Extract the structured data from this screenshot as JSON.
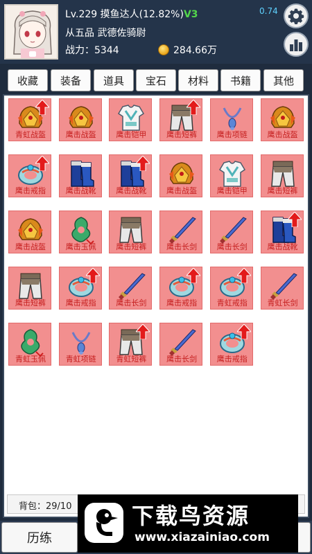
{
  "header": {
    "level_text": "Lv.229 摸鱼达人(12.82%)",
    "vip": "V3",
    "title": "从五品  武德佐骑尉",
    "power": "战力：5344",
    "gold": "284.66万",
    "top_stat": "0.74"
  },
  "tabs": [
    "收藏",
    "装备",
    "道具",
    "宝石",
    "材料",
    "书籍",
    "其他"
  ],
  "items": [
    {
      "name": "青虹战盔",
      "icon": "helmet-icon",
      "upgrade": true
    },
    {
      "name": "鹰击战盔",
      "icon": "helmet-icon",
      "upgrade": false
    },
    {
      "name": "鹰击铠甲",
      "icon": "armor-icon",
      "upgrade": false
    },
    {
      "name": "鹰击短裤",
      "icon": "pants-icon",
      "upgrade": true
    },
    {
      "name": "鹰击项链",
      "icon": "necklace-icon",
      "upgrade": false
    },
    {
      "name": "鹰击战盔",
      "icon": "helmet-icon",
      "upgrade": false
    },
    {
      "name": "鹰击戒指",
      "icon": "ring-icon",
      "upgrade": true
    },
    {
      "name": "鹰击战靴",
      "icon": "boots-icon",
      "upgrade": false
    },
    {
      "name": "鹰击战靴",
      "icon": "boots-icon",
      "upgrade": true
    },
    {
      "name": "鹰击战盔",
      "icon": "helmet-icon",
      "upgrade": false
    },
    {
      "name": "鹰击铠甲",
      "icon": "armor-icon",
      "upgrade": false
    },
    {
      "name": "鹰击短裤",
      "icon": "pants-icon",
      "upgrade": false
    },
    {
      "name": "鹰击战盔",
      "icon": "helmet-icon",
      "upgrade": false
    },
    {
      "name": "鹰击玉佩",
      "icon": "jade-pendant-icon",
      "upgrade": false
    },
    {
      "name": "鹰击短裤",
      "icon": "pants-icon",
      "upgrade": false
    },
    {
      "name": "鹰击长剑",
      "icon": "sword-icon",
      "upgrade": false
    },
    {
      "name": "鹰击长剑",
      "icon": "sword-icon",
      "upgrade": false
    },
    {
      "name": "鹰击战靴",
      "icon": "boots-icon",
      "upgrade": true
    },
    {
      "name": "鹰击短裤",
      "icon": "pants-icon",
      "upgrade": false
    },
    {
      "name": "鹰击戒指",
      "icon": "ring-icon",
      "upgrade": true
    },
    {
      "name": "鹰击长剑",
      "icon": "sword-icon",
      "upgrade": false
    },
    {
      "name": "鹰击戒指",
      "icon": "ring-icon",
      "upgrade": true
    },
    {
      "name": "青虹戒指",
      "icon": "ring-icon",
      "upgrade": true
    },
    {
      "name": "青虹长剑",
      "icon": "sword-icon",
      "upgrade": false
    },
    {
      "name": "青虹玉佩",
      "icon": "jade-pendant-icon",
      "upgrade": false
    },
    {
      "name": "青虹项链",
      "icon": "necklace-icon",
      "upgrade": false
    },
    {
      "name": "青虹短裤",
      "icon": "pants-icon",
      "upgrade": true
    },
    {
      "name": "鹰击长剑",
      "icon": "sword-icon",
      "upgrade": false
    },
    {
      "name": "鹰击戒指",
      "icon": "ring-icon",
      "upgrade": true
    }
  ],
  "bag": "背包：29/10",
  "bottom_nav": [
    "历练"
  ],
  "watermark": {
    "cn": "下载鸟资源",
    "url": "www.xiazainiao.com"
  },
  "colors": {
    "slot_bg": "#f28f8f",
    "label_red": "#c62020",
    "upgrade_arrow": "#e31b1b",
    "header_bg": "#24344a"
  }
}
